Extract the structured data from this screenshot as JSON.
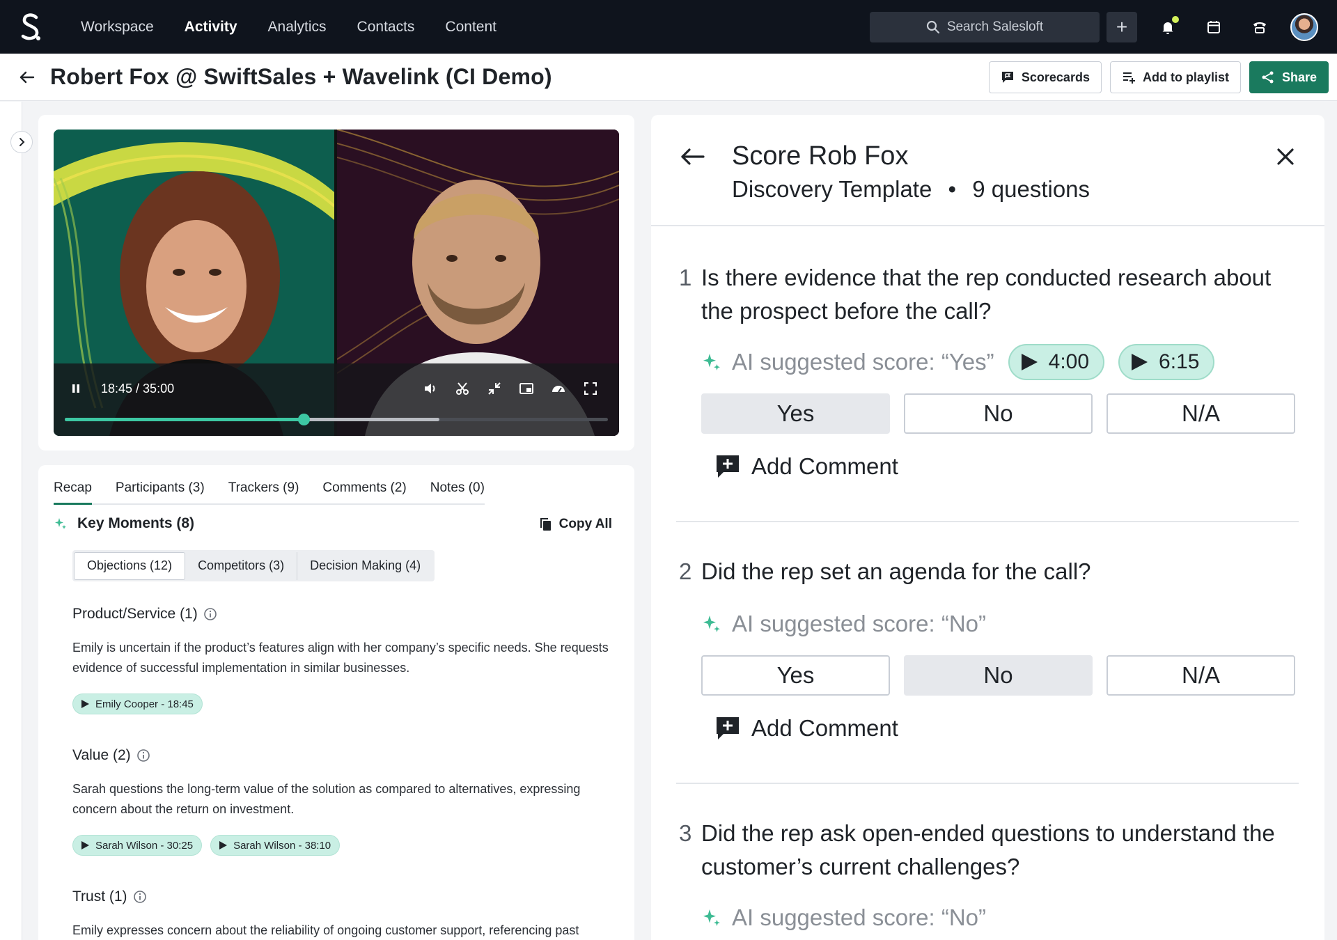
{
  "nav": {
    "logo": "S.",
    "items": [
      "Workspace",
      "Activity",
      "Analytics",
      "Contacts",
      "Content"
    ],
    "search_placeholder": "Search Salesloft",
    "plus": "+",
    "icons": [
      "search-icon",
      "bell-icon",
      "calendar-icon",
      "phone-icon"
    ]
  },
  "titlebar": {
    "title": "Robert Fox @ SwiftSales + Wavelink (CI Demo)",
    "scorecards": "Scorecards",
    "add_to_playlist": "Add to playlist",
    "share": "Share"
  },
  "video": {
    "time": "18:45 / 35:00",
    "progress_fraction": 0.44,
    "buffered_fraction": 0.69,
    "accent": "#3dc8a3"
  },
  "recap": {
    "tabs": [
      "Recap",
      "Participants (3)",
      "Trackers (9)",
      "Comments (2)",
      "Notes (0)"
    ],
    "key_moments": "Key Moments (8)",
    "copy_all": "Copy All",
    "segments": [
      "Objections (12)",
      "Competitors (3)",
      "Decision Making (4)"
    ],
    "moments": [
      {
        "title": "Product/Service (1)",
        "desc": "Emily is uncertain if the product’s features align with her company’s specific needs. She requests evidence of successful implementation in similar businesses.",
        "chips": [
          "Emily Cooper - 18:45"
        ]
      },
      {
        "title": "Value (2)",
        "desc": "Sarah questions the long-term value of the solution as compared to alternatives, expressing concern about the return on investment.",
        "chips": [
          "Sarah Wilson - 30:25",
          "Sarah Wilson - 38:10"
        ]
      },
      {
        "title": "Trust (1)",
        "desc": "Emily expresses concern about the reliability of ongoing customer support, referencing past"
      }
    ]
  },
  "score": {
    "title": "Score Rob Fox",
    "template": "Discovery Template",
    "separator": "•",
    "count": "9 questions",
    "choices": [
      "Yes",
      "No",
      "N/A"
    ],
    "add_comment": "Add Comment",
    "questions": [
      {
        "num": "1",
        "text": "Is there evidence that the rep conducted research about the prospect before the call?",
        "ai": "AI suggested score: “Yes”",
        "timestamps": [
          "4:00",
          "6:15"
        ],
        "selected": "Yes"
      },
      {
        "num": "2",
        "text": "Did the rep set an agenda for the call?",
        "ai": "AI suggested score: “No”",
        "selected": "No"
      },
      {
        "num": "3",
        "text": "Did the rep ask open-ended questions to understand the customer’s current challenges?",
        "ai": "AI suggested score: “No”"
      }
    ]
  },
  "colors": {
    "brand_green": "#1a7a5e",
    "chip_bg": "#c9efe4",
    "nav_bg": "#0f141d"
  }
}
